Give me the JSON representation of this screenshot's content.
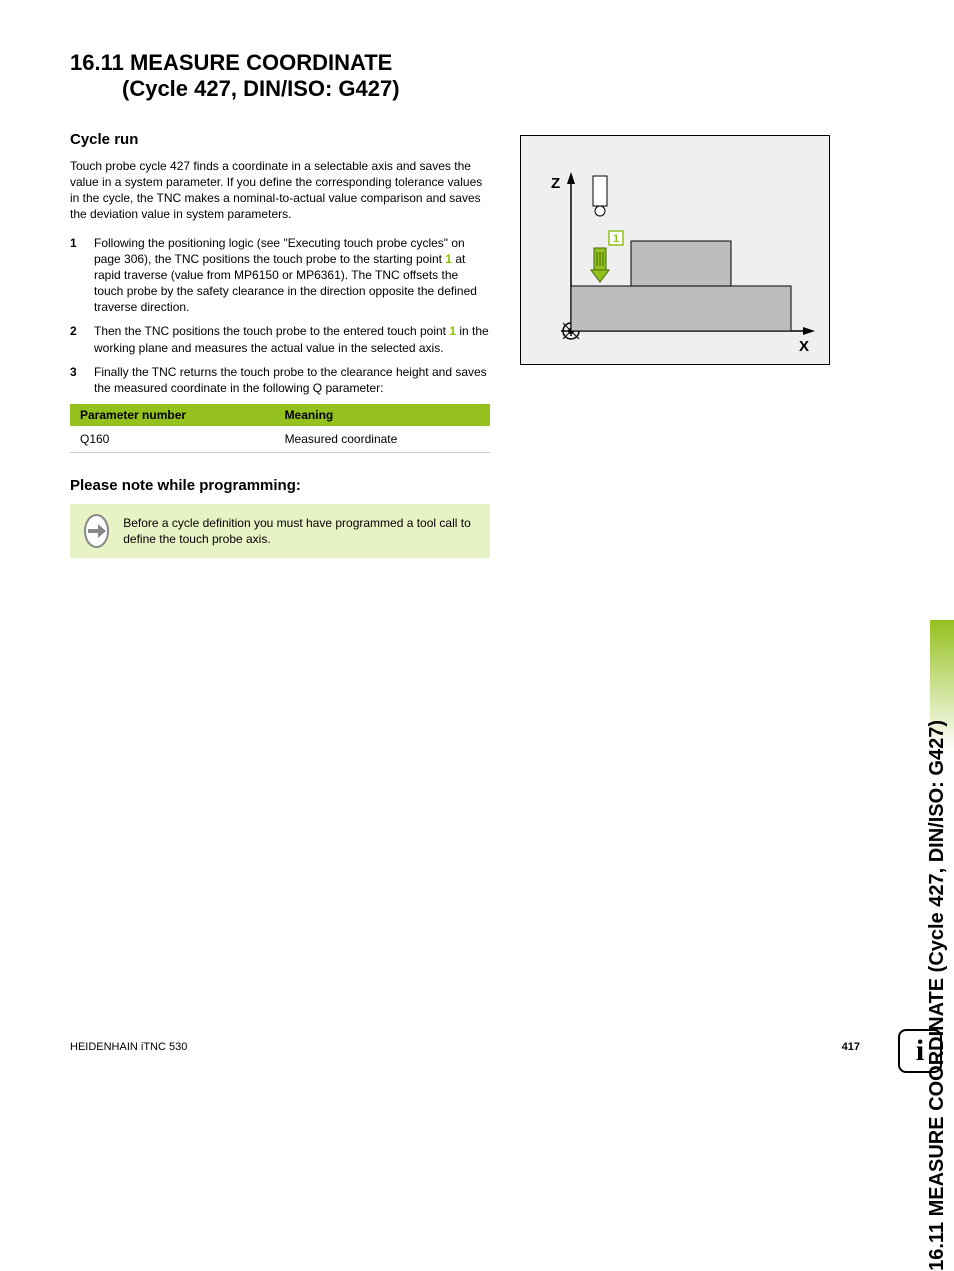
{
  "title_line1": "16.11 MEASURE COORDINATE",
  "title_line2": "(Cycle 427, DIN/ISO: G427)",
  "side_tab": "16.11 MEASURE COORDINATE (Cycle 427, DIN/ISO: G427)",
  "section_cycle_run": "Cycle run",
  "intro": "Touch probe cycle 427 finds a coordinate in a selectable axis and saves the value in a system parameter. If you define the corresponding tolerance values in the cycle, the TNC makes a nominal-to-actual value comparison and saves the deviation value in system parameters.",
  "steps": [
    {
      "n": "1",
      "pre": "Following the positioning logic (see \"Executing touch probe cycles\" on page 306), the TNC positions the touch probe to the starting point ",
      "hl": "1",
      "post": " at rapid traverse (value from MP6150 or MP6361). The TNC offsets the touch probe by the safety clearance in the direction opposite the defined traverse direction."
    },
    {
      "n": "2",
      "pre": "Then the TNC positions the touch probe to the entered touch point ",
      "hl": "1",
      "post": " in the working plane and measures the actual value in the selected axis."
    },
    {
      "n": "3",
      "pre": "Finally the TNC returns the touch probe to the clearance height and saves the measured coordinate in the following Q parameter:",
      "hl": "",
      "post": ""
    }
  ],
  "table": {
    "h1": "Parameter number",
    "h2": "Meaning",
    "r1c1": "Q160",
    "r1c2": "Measured coordinate"
  },
  "section_note": "Please note while programming:",
  "note_text": "Before a cycle definition you must have programmed a tool call to define the touch probe axis.",
  "diagram": {
    "z": "Z",
    "x": "X",
    "pt": "1"
  },
  "footer_left": "HEIDENHAIN iTNC 530",
  "footer_page": "417",
  "info_icon": "i"
}
